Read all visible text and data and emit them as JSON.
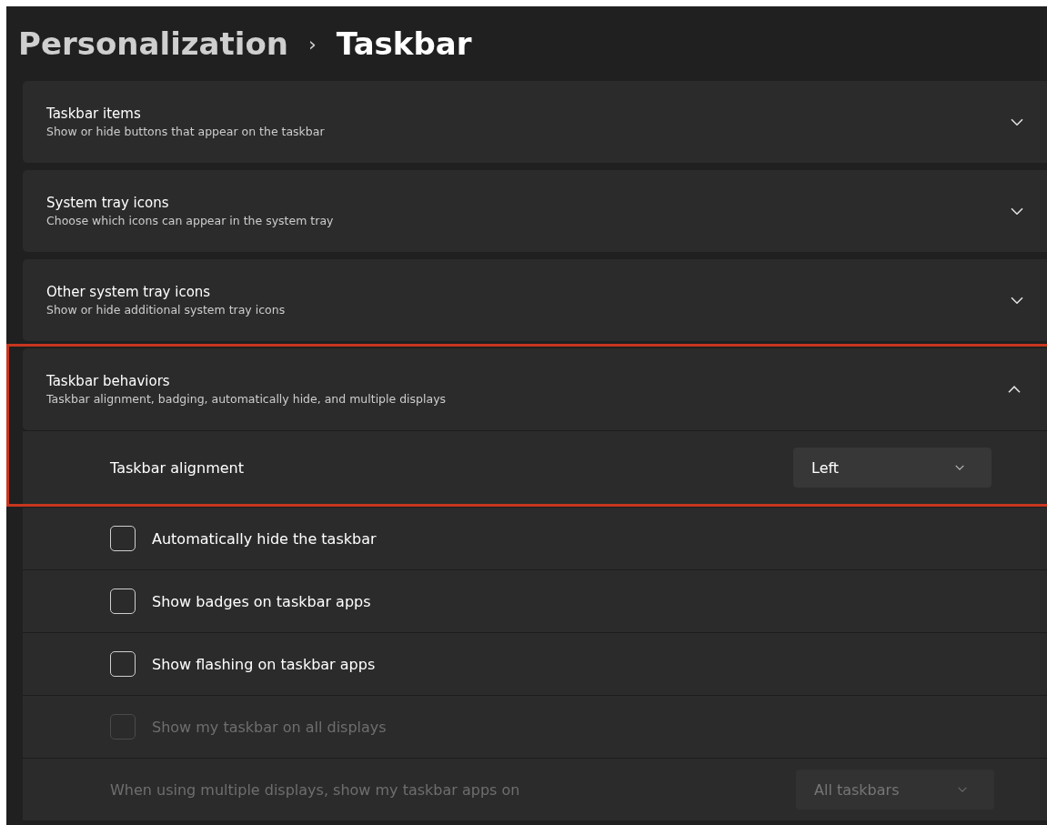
{
  "breadcrumb": {
    "parent": "Personalization",
    "separator": "›",
    "current": "Taskbar"
  },
  "sections": [
    {
      "title": "Taskbar items",
      "description": "Show or hide buttons that appear on the taskbar",
      "expanded": false,
      "highlighted": false
    },
    {
      "title": "System tray icons",
      "description": "Choose which icons can appear in the system tray",
      "expanded": false,
      "highlighted": false
    },
    {
      "title": "Other system tray icons",
      "description": "Show or hide additional system tray icons",
      "expanded": false,
      "highlighted": false
    },
    {
      "title": "Taskbar behaviors",
      "description": "Taskbar alignment, badging, automatically hide, and multiple displays",
      "expanded": true,
      "highlighted": true,
      "children": [
        {
          "kind": "dropdown",
          "label": "Taskbar alignment",
          "value": "Left",
          "disabled": false,
          "highlighted": true
        },
        {
          "kind": "checkbox",
          "label": "Automatically hide the taskbar",
          "checked": false,
          "disabled": false,
          "highlighted": false
        },
        {
          "kind": "checkbox",
          "label": "Show badges on taskbar apps",
          "checked": false,
          "disabled": false,
          "highlighted": false
        },
        {
          "kind": "checkbox",
          "label": "Show flashing on taskbar apps",
          "checked": false,
          "disabled": false,
          "highlighted": false
        },
        {
          "kind": "checkbox",
          "label": "Show my taskbar on all displays",
          "checked": false,
          "disabled": true,
          "highlighted": false
        },
        {
          "kind": "dropdown",
          "label": "When using multiple displays, show my taskbar apps on",
          "value": "All taskbars",
          "disabled": true,
          "highlighted": false
        }
      ]
    }
  ]
}
